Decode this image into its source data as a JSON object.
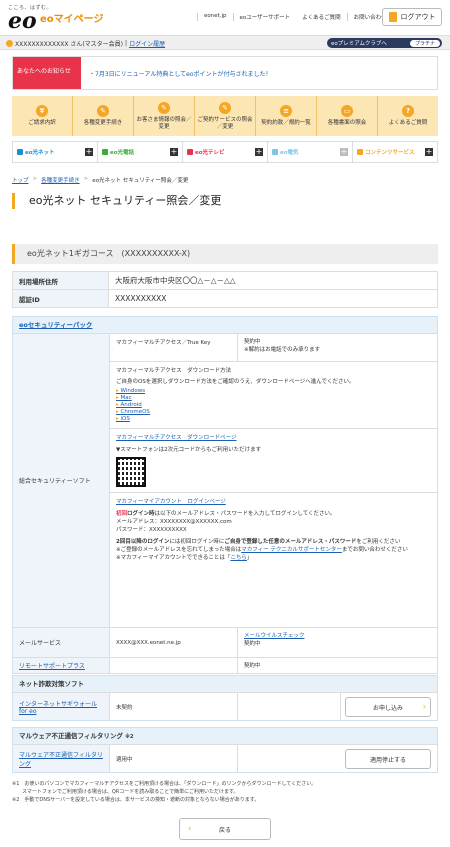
{
  "header": {
    "tagline": "こころ、はずむ。",
    "logo": "eo",
    "mypage": "eoマイページ",
    "nav": [
      "eonet.jp",
      "eoユーザーサポート",
      "よくあるご質問",
      "お問い合わせ"
    ],
    "logout": "ログアウト"
  },
  "userbar": {
    "user": "XXXXXXXXXXXXX さん(マスター会員)",
    "login_history": "ログイン履歴",
    "premium": "eoプレミアムクラブへ",
    "premium_level": "プラチナ"
  },
  "notice": {
    "label": "あなたへのお知らせ",
    "text": "・7月3日にリニューアル特典としてeoポイントが付与されました！"
  },
  "menu": [
    {
      "label": "ご請求内訳",
      "icon": "yen-icon"
    },
    {
      "label": "各種変更手続き",
      "icon": "edit-icon"
    },
    {
      "label": "お客さま情報の照会／変更",
      "icon": "user-edit-icon"
    },
    {
      "label": "ご契約サービスの照会／変更",
      "icon": "contract-icon"
    },
    {
      "label": "契約約款／規約一覧",
      "icon": "document-icon"
    },
    {
      "label": "各種書面の照会",
      "icon": "folder-icon"
    },
    {
      "label": "よくあるご質問",
      "icon": "question-icon"
    }
  ],
  "services": [
    {
      "label": "eo光ネット",
      "color": "#1a8fd6"
    },
    {
      "label": "eo光電話",
      "color": "#3cab3a"
    },
    {
      "label": "eo光テレビ",
      "color": "#e8334a"
    },
    {
      "label": "eo電気",
      "color": "#7fc6e8"
    },
    {
      "label": "コンテンツサービス",
      "color": "#f5a623"
    }
  ],
  "breadcrumb": [
    "トップ",
    "各種変更手続き",
    "eo光ネット セキュリティー照会／変更"
  ],
  "page_title": "eo光ネット セキュリティー照会／変更",
  "course": "eo光ネット1ギガコース　(XXXXXXXXXX-X)",
  "info": {
    "address_label": "利用場所住所",
    "address": "大阪府大阪市中央区〇〇△－△－△△",
    "auth_label": "認証ID",
    "auth": "XXXXXXXXXX"
  },
  "security": {
    "title": "eoセキュリティーパック",
    "general_label": "総合セキュリティーソフト",
    "mcafee_access": "マカフィーマルチアクセス／True Key",
    "status_line1": "契約中",
    "status_line2": "※解約はお電話でのみ承ります",
    "download_title": "マカフィーマルチアクセス　ダウンロード方法",
    "download_text": "ご自身のOSを選択しダウンロード方法をご確認のうえ、ダウンロードページへ進んでください。",
    "os": [
      "Windows",
      "Mac",
      "Android",
      "ChromeOS",
      "iOS"
    ],
    "download_page": "マカフィーマルチアクセス　ダウンロードページ",
    "qr_text": "▼スマートフォンは2次元コードからもご利用いただけます",
    "account_login": "マカフィーマイアカウント　ログインページ",
    "first_login_a": "初回",
    "first_login_b": "ログイン時",
    "first_login_c": "は以下のメールアドレス・パスワードを入力してログインしてください。",
    "mail_line": "メールアドレス：XXXXXXXX@XXXXXX.com",
    "pass_line": "パスワード：XXXXXXXXXX",
    "second_a": "2回目以降のログイン",
    "second_b": "には初回ログイン時に",
    "second_c": "ご自身で登録した任意のメールアドレス・パスワード",
    "second_d": "をご利用ください",
    "forgot_a": "※ご登録のメールアドレスを忘れてしまった場合は",
    "forgot_link": "マカフィー テクニカルサポートセンター",
    "forgot_b": "までお問い合わせください",
    "account_a": "※マカフィーマイアカウントでできることは「",
    "account_link": "こちら",
    "account_b": "」",
    "mail_label": "メールサービス",
    "mail_address": "XXXX@XXX.eonet.ne.jp",
    "virus_check": "メールウイルスチェック",
    "virus_status": "契約中",
    "remote_label": "リモートサポートプラス",
    "remote_status": "契約中"
  },
  "fraud": {
    "title": "ネット詐欺対策ソフト",
    "label": "インターネットサギウォール for eo",
    "status": "未契約",
    "button": "お申し込み"
  },
  "malware": {
    "title": "マルウェア不正通信フィルタリング",
    "note_mark": "※2",
    "label": "マルウェア不正通信フィルタリング",
    "status": "適用中",
    "button": "適用停止する"
  },
  "notes": [
    "※1　お使いのパソコンでマカフィーマルチアクセスをご利用頂ける場合は、「ダウンロード」のリンクからダウンロードしてください。",
    "　　スマートフォンでご利用頂ける場合は、QRコードを読み取ることで簡単にご利用いただけます。",
    "※2　手動でDNSサーバーを設定している場合は、本サービスの検知・遮断の対象とならない場合があります。"
  ],
  "back": "戻る"
}
